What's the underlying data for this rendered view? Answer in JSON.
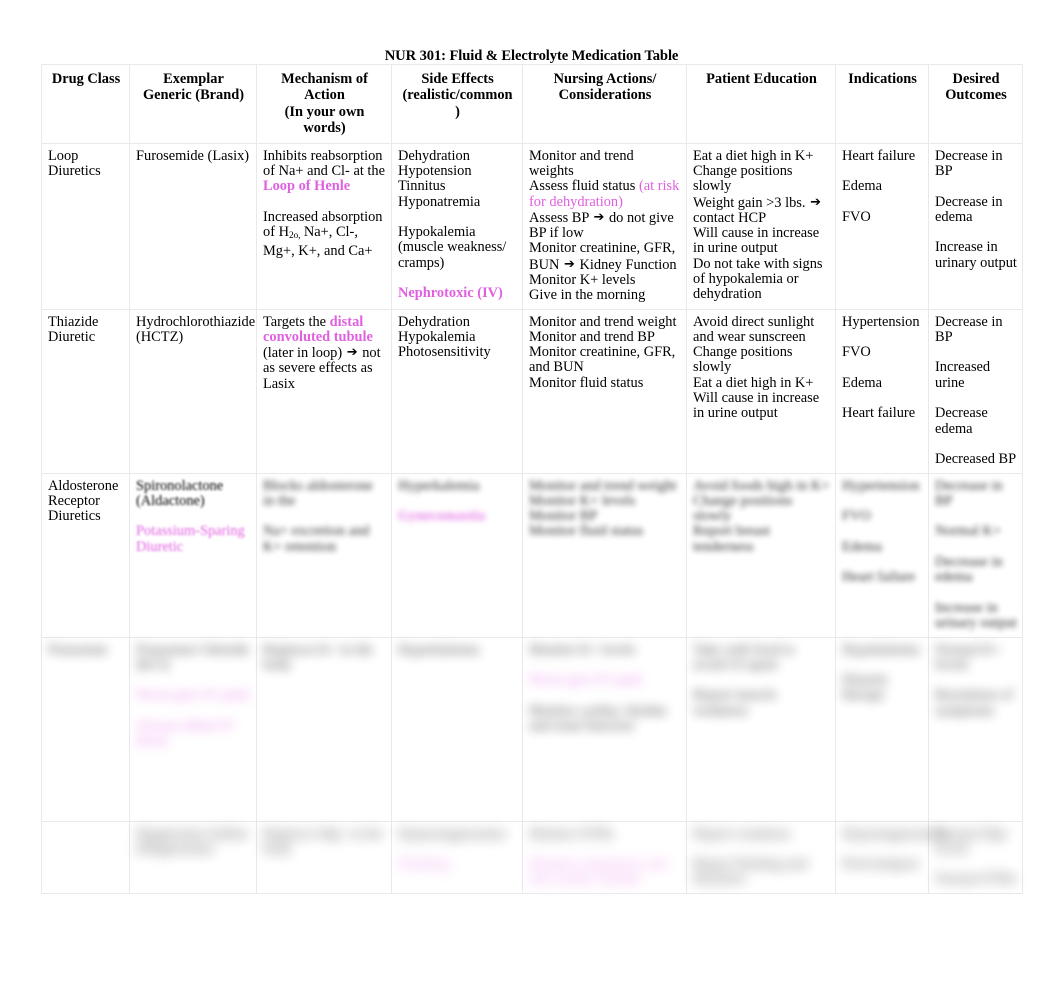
{
  "document": {
    "title": "NUR 301: Fluid & Electrolyte Medication Table"
  },
  "colors": {
    "highlight_pink": "#e15fe1",
    "text": "#000000",
    "border": "#e9e9ec",
    "background": "#ffffff"
  },
  "table": {
    "headers": [
      "Drug Class",
      "Exemplar\nGeneric (Brand)",
      "Mechanism of Action\n(In your own words)",
      "Side Effects\n(realistic/common\n)",
      "Nursing Actions/\nConsiderations",
      "Patient Education",
      "Indications",
      "Desired\nOutcomes"
    ],
    "rows": [
      {
        "id": "loop-diuretics",
        "blur": "none",
        "drug_class": [
          "Loop Diuretics"
        ],
        "exemplar": [
          "Furosemide (Lasix)"
        ],
        "mechanism": [
          {
            "text": "Inhibits reabsorption of Na+ and Cl- at the ",
            "style": "plain"
          },
          {
            "text": "Loop of Henle",
            "style": "pink-bold"
          },
          {
            "text": "",
            "style": "blank"
          },
          {
            "text": "Increased absorption of H2o, Na+, Cl-, Mg+, K+, and Ca+",
            "style": "plain"
          }
        ],
        "side_effects": [
          {
            "text": "Dehydration",
            "style": "plain"
          },
          {
            "text": "Hypotension",
            "style": "plain"
          },
          {
            "text": "Tinnitus",
            "style": "plain"
          },
          {
            "text": "Hyponatremia",
            "style": "plain"
          },
          {
            "text": "",
            "style": "blank"
          },
          {
            "text": "Hypokalemia (muscle weakness/ cramps)",
            "style": "plain"
          },
          {
            "text": "",
            "style": "blank"
          },
          {
            "text": "Nephrotoxic (IV)",
            "style": "pink-bold"
          }
        ],
        "nursing_actions": [
          {
            "text": "Monitor and trend weights",
            "style": "plain"
          },
          {
            "text": "Assess fluid status ",
            "style": "plain",
            "suffix_pink": "(at risk for dehydration)"
          },
          {
            "text": "Assess BP ",
            "style": "arrow",
            "after": "do not give BP if low"
          },
          {
            "text": "Monitor creatinine, GFR, BUN ",
            "style": "arrow",
            "after": "Kidney Function"
          },
          {
            "text": "Monitor K+ levels",
            "style": "plain"
          },
          {
            "text": "Give in the morning",
            "style": "plain"
          }
        ],
        "patient_education": [
          {
            "text": "Eat a diet high in K+",
            "style": "plain"
          },
          {
            "text": "Change positions slowly",
            "style": "plain"
          },
          {
            "text": "Weight gain >3 lbs. ",
            "style": "arrow",
            "after": "contact HCP"
          },
          {
            "text": "Will cause in increase in urine output",
            "style": "plain"
          },
          {
            "text": "Do not take with signs of hypokalemia or dehydration",
            "style": "plain"
          }
        ],
        "indications": [
          {
            "text": "Heart failure",
            "style": "plain"
          },
          {
            "text": "",
            "style": "blank"
          },
          {
            "text": "Edema",
            "style": "plain"
          },
          {
            "text": "",
            "style": "blank"
          },
          {
            "text": "FVO",
            "style": "plain"
          }
        ],
        "desired_outcomes": [
          {
            "text": "Decrease in BP",
            "style": "plain"
          },
          {
            "text": "",
            "style": "blank"
          },
          {
            "text": "Decrease in edema",
            "style": "plain"
          },
          {
            "text": "",
            "style": "blank"
          },
          {
            "text": "Increase in urinary output",
            "style": "plain"
          }
        ]
      },
      {
        "id": "thiazide-diuretic",
        "blur": "none",
        "drug_class": [
          "Thiazide Diuretic"
        ],
        "exemplar": [
          "Hydrochlorothiazide (HCTZ)"
        ],
        "mechanism": [
          {
            "text": "Targets the ",
            "style": "plain",
            "inline_pink": "distal convoluted tubule"
          },
          {
            "text": "(later in loop) ",
            "style": "arrow",
            "after": "not as severe effects as Lasix"
          }
        ],
        "side_effects": [
          {
            "text": "Dehydration",
            "style": "plain"
          },
          {
            "text": "Hypokalemia",
            "style": "plain"
          },
          {
            "text": "Photosensitivity",
            "style": "plain"
          }
        ],
        "nursing_actions": [
          {
            "text": "Monitor and trend weight",
            "style": "plain"
          },
          {
            "text": "Monitor and trend BP",
            "style": "plain"
          },
          {
            "text": "Monitor creatinine, GFR, and BUN",
            "style": "plain"
          },
          {
            "text": "Monitor fluid status",
            "style": "plain"
          }
        ],
        "patient_education": [
          {
            "text": "Avoid direct sunlight and wear sunscreen",
            "style": "plain"
          },
          {
            "text": "Change positions slowly",
            "style": "plain"
          },
          {
            "text": "Eat a diet high in K+",
            "style": "plain"
          },
          {
            "text": "Will cause in increase in urine output",
            "style": "plain"
          }
        ],
        "indications": [
          {
            "text": "Hypertension",
            "style": "plain"
          },
          {
            "text": "",
            "style": "blank"
          },
          {
            "text": "FVO",
            "style": "plain"
          },
          {
            "text": "",
            "style": "blank"
          },
          {
            "text": "Edema",
            "style": "plain"
          },
          {
            "text": "",
            "style": "blank"
          },
          {
            "text": "Heart failure",
            "style": "plain"
          }
        ],
        "desired_outcomes": [
          {
            "text": "Decrease in BP",
            "style": "plain"
          },
          {
            "text": "",
            "style": "blank"
          },
          {
            "text": "Increased urine",
            "style": "plain"
          },
          {
            "text": "",
            "style": "blank"
          },
          {
            "text": "Decrease edema",
            "style": "plain"
          },
          {
            "text": "",
            "style": "blank"
          },
          {
            "text": "Decreased BP",
            "style": "plain"
          }
        ]
      },
      {
        "id": "aldosterone-receptor-diuretics",
        "blur": "partial",
        "drug_class": [
          "Aldosterone Receptor Diuretics"
        ],
        "exemplar": [
          {
            "text": "Spironolactone (Aldactone)",
            "style": "plain"
          },
          {
            "text": "",
            "style": "blank"
          },
          {
            "text": "Potassium-Sparing Diuretic",
            "style": "pink"
          }
        ],
        "mechanism": [
          {
            "text": "Blocks aldosterone in the",
            "style": "plain"
          },
          {
            "text": "",
            "style": "blank"
          },
          {
            "text": "Na+ excretion and K+ retention",
            "style": "plain"
          }
        ],
        "side_effects": [
          {
            "text": "Hyperkalemia",
            "style": "plain"
          },
          {
            "text": "",
            "style": "blank"
          },
          {
            "text": "Gynecomastia",
            "style": "pink-bold"
          }
        ],
        "nursing_actions": [
          {
            "text": "Monitor and trend weight",
            "style": "plain"
          },
          {
            "text": "Monitor K+ levels",
            "style": "plain"
          },
          {
            "text": "Monitor BP",
            "style": "plain"
          },
          {
            "text": "Monitor fluid status",
            "style": "plain"
          }
        ],
        "patient_education": [
          {
            "text": "Avoid foods high in K+",
            "style": "plain"
          },
          {
            "text": "Change positions slowly",
            "style": "plain"
          },
          {
            "text": "Report breast tenderness",
            "style": "plain"
          }
        ],
        "indications": [
          {
            "text": "Hypertension",
            "style": "plain"
          },
          {
            "text": "",
            "style": "blank"
          },
          {
            "text": "FVO",
            "style": "plain"
          },
          {
            "text": "",
            "style": "blank"
          },
          {
            "text": "Edema",
            "style": "plain"
          },
          {
            "text": "",
            "style": "blank"
          },
          {
            "text": "Heart failure",
            "style": "plain"
          }
        ],
        "desired_outcomes": [
          {
            "text": "Decrease in BP",
            "style": "plain"
          },
          {
            "text": "",
            "style": "blank"
          },
          {
            "text": "Normal K+",
            "style": "plain"
          },
          {
            "text": "",
            "style": "blank"
          },
          {
            "text": "Decrease in edema",
            "style": "plain"
          },
          {
            "text": "",
            "style": "blank"
          },
          {
            "text": "Increase in urinary output",
            "style": "plain"
          }
        ]
      },
      {
        "id": "row-4",
        "blur": "full",
        "drug_class": [
          "Potassium"
        ],
        "exemplar": [
          {
            "text": "Potassium Chloride (KCl)",
            "style": "plain"
          },
          {
            "text": "",
            "style": "blank"
          },
          {
            "text": "Never give IV push",
            "style": "pink"
          },
          {
            "text": "",
            "style": "blank"
          },
          {
            "text": "Always dilute IV doses",
            "style": "pink"
          }
        ],
        "mechanism": [
          {
            "text": "Replaces K+ in the body",
            "style": "plain"
          }
        ],
        "side_effects": [
          {
            "text": "Hyperkalemia",
            "style": "plain"
          }
        ],
        "nursing_actions": [
          {
            "text": "Monitor K+ levels",
            "style": "plain"
          },
          {
            "text": "",
            "style": "blank"
          },
          {
            "text": "Never give IV push",
            "style": "pink"
          },
          {
            "text": "",
            "style": "blank"
          },
          {
            "text": "Monitor cardiac rhythm and renal function",
            "style": "plain"
          }
        ],
        "patient_education": [
          {
            "text": "Take with food to avoid GI upset",
            "style": "plain"
          },
          {
            "text": "",
            "style": "blank"
          },
          {
            "text": "Report muscle weakness",
            "style": "plain"
          }
        ],
        "indications": [
          {
            "text": "Hypokalemia",
            "style": "plain"
          },
          {
            "text": "",
            "style": "blank"
          },
          {
            "text": "Diuretic therapy",
            "style": "plain"
          }
        ],
        "desired_outcomes": [
          {
            "text": "Normal K+ levels",
            "style": "plain"
          },
          {
            "text": "",
            "style": "blank"
          },
          {
            "text": "Resolution of symptoms",
            "style": "plain"
          }
        ]
      },
      {
        "id": "row-5",
        "blur": "full",
        "drug_class": [
          ""
        ],
        "exemplar": [
          {
            "text": "Magnesium Sulfate",
            "style": "plain"
          },
          {
            "text": "(Magnesium)",
            "style": "plain"
          }
        ],
        "mechanism": [
          {
            "text": "Replaces Mg+ in the body",
            "style": "plain"
          }
        ],
        "side_effects": [
          {
            "text": "Hypermagnesemia",
            "style": "plain"
          },
          {
            "text": "",
            "style": "blank"
          },
          {
            "text": "Flushing",
            "style": "pink"
          }
        ],
        "nursing_actions": [
          {
            "text": "Monitor DTRs",
            "style": "plain"
          },
          {
            "text": "",
            "style": "blank"
          },
          {
            "text": "Monitor respiratory rate and cardiac rhythm",
            "style": "pink"
          }
        ],
        "patient_education": [
          {
            "text": "Report weakness",
            "style": "plain"
          },
          {
            "text": "",
            "style": "blank"
          },
          {
            "text": "Report flushing and dizziness",
            "style": "plain"
          }
        ],
        "indications": [
          {
            "text": "Hypomagnesemia",
            "style": "plain"
          },
          {
            "text": "",
            "style": "blank"
          },
          {
            "text": "Preeclampsia",
            "style": "plain"
          }
        ],
        "desired_outcomes": [
          {
            "text": "Normal Mg+ levels",
            "style": "plain"
          },
          {
            "text": "",
            "style": "blank"
          },
          {
            "text": "Normal DTRs",
            "style": "plain"
          }
        ]
      }
    ]
  }
}
